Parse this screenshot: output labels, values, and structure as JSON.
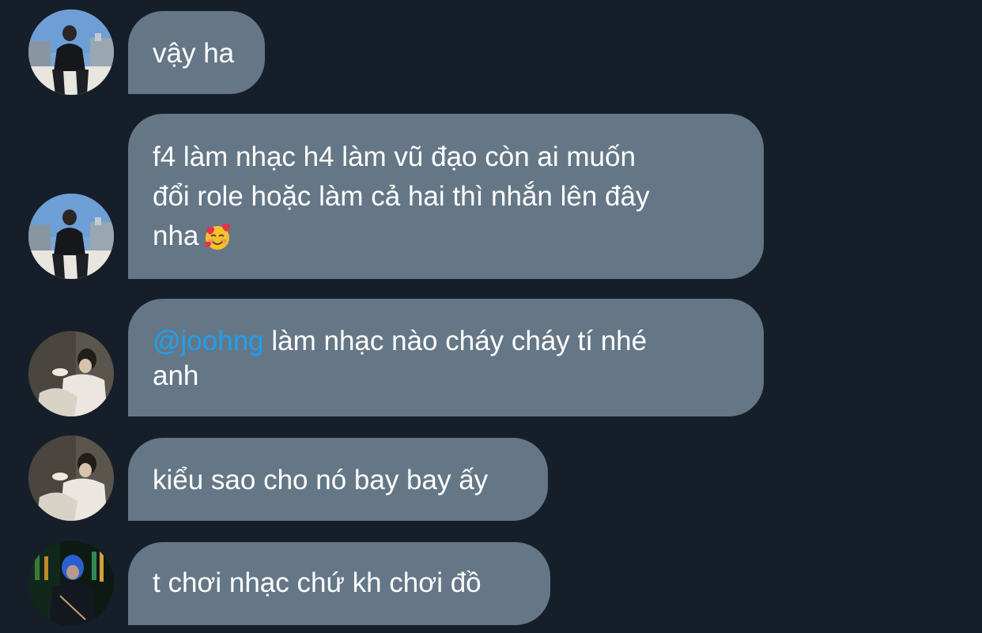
{
  "messages": [
    {
      "avatar": "user-street-photo",
      "lines": [
        "vậy ha"
      ]
    },
    {
      "avatar": "user-street-photo",
      "lines": [
        "f4 làm nhạc h4 làm vũ đạo còn ai muốn",
        "đổi role hoặc làm cả hai thì nhắn lên đây",
        "nha"
      ],
      "emoji": "smiling-face-with-hearts-icon"
    },
    {
      "avatar": "user-indoor-photo",
      "mention": "@joohng",
      "lines": [
        " làm nhạc nào cháy cháy tí nhé",
        "anh"
      ]
    },
    {
      "avatar": "user-indoor-photo",
      "lines": [
        "kiểu sao cho nó bay bay ấy"
      ]
    },
    {
      "avatar": "user-neon-photo",
      "lines": [
        "t chơi nhạc chứ kh chơi đồ"
      ]
    }
  ],
  "colors": {
    "background": "#161f29",
    "bubble": "#657786",
    "mention": "#1da1f2",
    "text": "#ffffff"
  }
}
